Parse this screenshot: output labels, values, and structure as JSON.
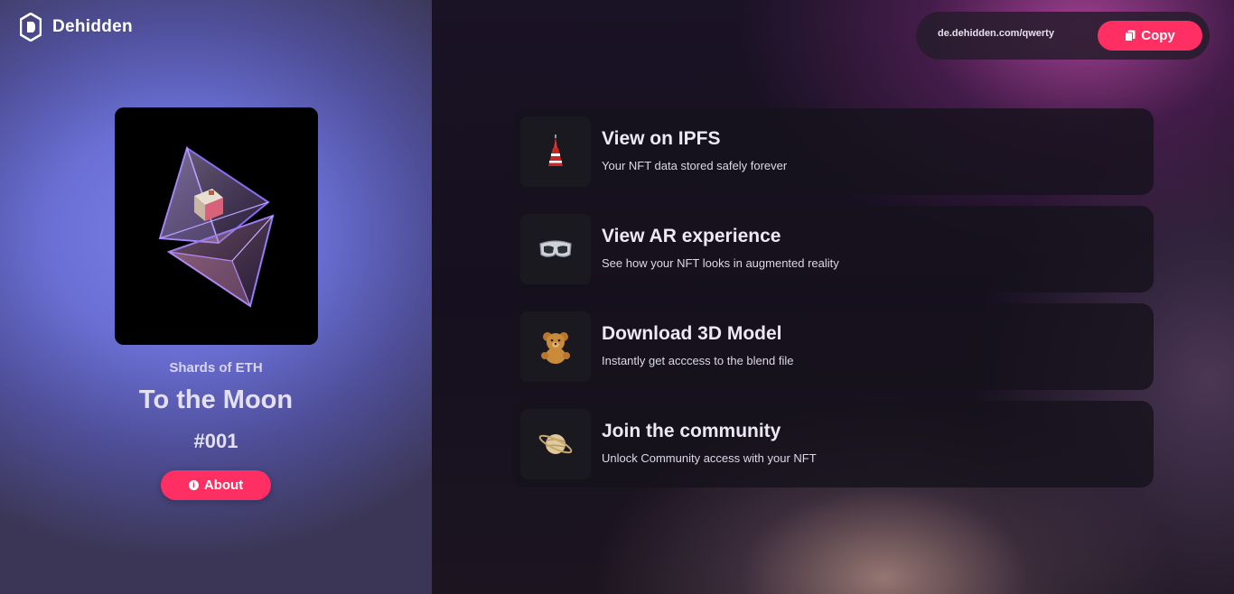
{
  "brand": {
    "name": "Dehidden",
    "icon": "dehidden-logo-icon"
  },
  "nft": {
    "image_icon": "eth-crystal-artwork",
    "collection": "Shards of ETH",
    "title": "To the Moon",
    "number": "#001",
    "about_label": "About"
  },
  "share": {
    "link": "de.dehidden.com/qwerty",
    "copy_label": "Copy"
  },
  "actions": [
    {
      "title": "View on IPFS",
      "subtitle": "Your NFT data stored safely forever",
      "icon": "tower-icon"
    },
    {
      "title": "View AR experience",
      "subtitle": "See how your NFT looks in augmented reality",
      "icon": "ar-goggles-icon"
    },
    {
      "title": "Download 3D Model",
      "subtitle": "Instantly get acccess to the blend file",
      "icon": "teddy-bear-icon"
    },
    {
      "title": "Join the community",
      "subtitle": "Unlock Community access with your NFT",
      "icon": "planet-icon"
    }
  ],
  "colors": {
    "accent": "#ff2e63",
    "card_bg": "#16121c",
    "left_bg": "#6a6fd4"
  }
}
